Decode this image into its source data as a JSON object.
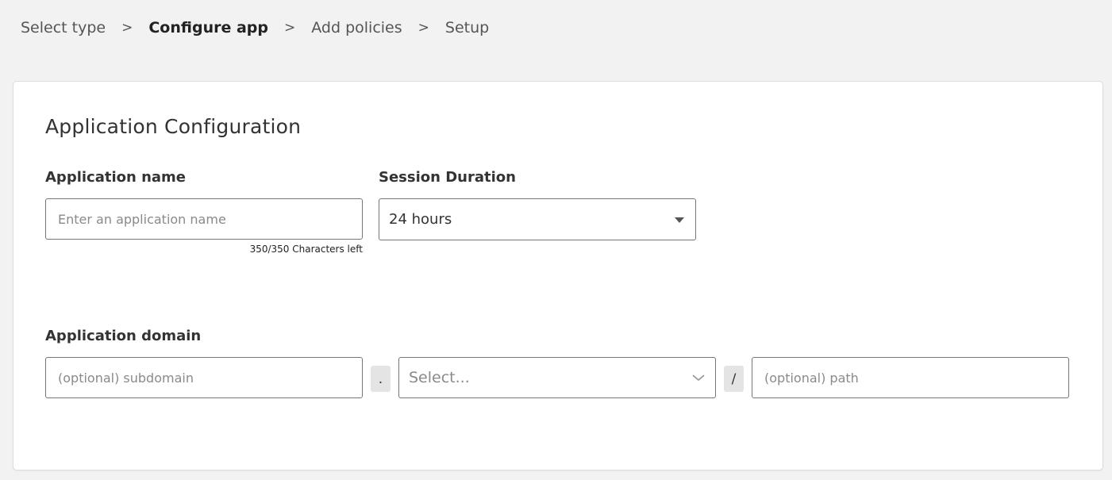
{
  "breadcrumb": {
    "steps": [
      "Select type",
      "Configure app",
      "Add policies",
      "Setup"
    ],
    "separator": ">",
    "active_index": 1
  },
  "form": {
    "title": "Application Configuration",
    "app_name": {
      "label": "Application name",
      "value": "",
      "placeholder": "Enter an application name",
      "counter": "350/350 Characters left"
    },
    "session_duration": {
      "label": "Session Duration",
      "value": "24 hours"
    },
    "domain": {
      "label": "Application domain",
      "subdomain_value": "",
      "subdomain_placeholder": "(optional) subdomain",
      "dot_joiner": ".",
      "domain_select_placeholder": "Select...",
      "slash_joiner": "/",
      "path_value": "",
      "path_placeholder": "(optional) path"
    }
  },
  "icons": {
    "session_dropdown": "caret-down-icon",
    "domain_dropdown": "chevron-down-icon"
  },
  "colors": {
    "page_background": "#f2f2f2",
    "card_background": "#ffffff",
    "input_border": "#767676",
    "joiner_background": "#e4e4e4"
  }
}
